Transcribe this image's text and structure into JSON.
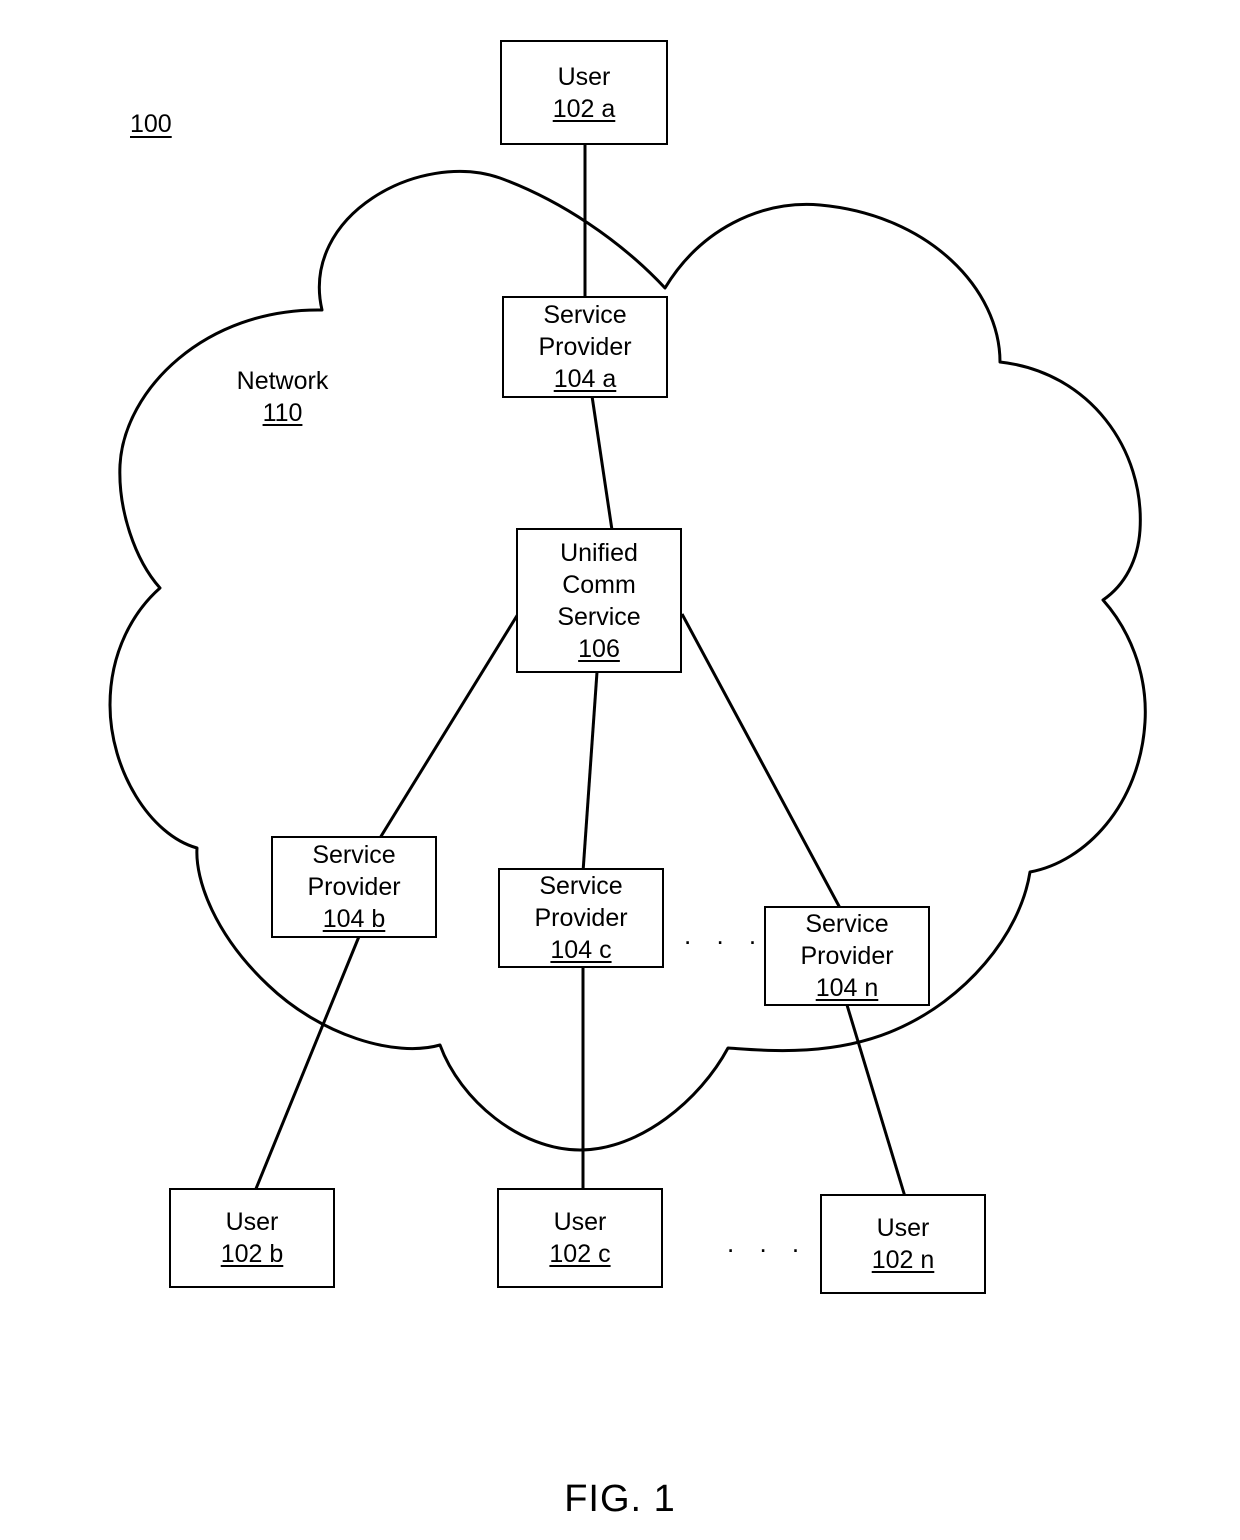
{
  "figure": {
    "caption": "FIG. 1",
    "system_ref": "100"
  },
  "network": {
    "label": "Network",
    "ref": "110"
  },
  "nodes": {
    "user_a": {
      "title": "User",
      "ref": "102 a"
    },
    "user_b": {
      "title": "User",
      "ref": "102 b"
    },
    "user_c": {
      "title": "User",
      "ref": "102 c"
    },
    "user_n": {
      "title": "User",
      "ref": "102 n"
    },
    "service_provider_a": {
      "line1": "Service",
      "line2": "Provider",
      "ref": "104 a"
    },
    "service_provider_b": {
      "line1": "Service",
      "line2": "Provider",
      "ref": "104 b"
    },
    "service_provider_c": {
      "line1": "Service",
      "line2": "Provider",
      "ref": "104 c"
    },
    "service_provider_n": {
      "line1": "Service",
      "line2": "Provider",
      "ref": "104 n"
    },
    "unified_comm_service": {
      "line1": "Unified",
      "line2": "Comm",
      "line3": "Service",
      "ref": "106"
    }
  },
  "ellipses": {
    "providers": ". . .",
    "users": ". . ."
  },
  "colors": {
    "stroke": "#000000",
    "background": "#ffffff"
  }
}
